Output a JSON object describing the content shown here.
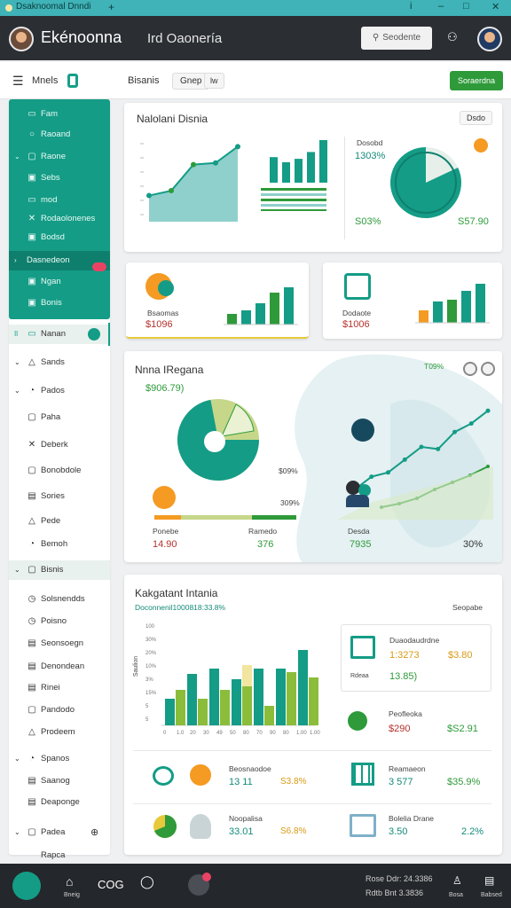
{
  "window": {
    "title": "Dsaknoomal Dnndi",
    "new_tab": "+",
    "info": "i",
    "minimize": "–",
    "maximize": "□",
    "close": "✕"
  },
  "header": {
    "brand": "Ekénoonna",
    "subtitle": "Ird Oaonería",
    "button": "Seodente",
    "icon": "people-icon"
  },
  "toolbar": {
    "menu_label": "Mnels",
    "title": "Bisanis",
    "chip1": "Gnep",
    "chip2": "lw",
    "action": "Soraerdna"
  },
  "sidebar": {
    "green_items": [
      {
        "label": "Fam",
        "icon": "card-icon"
      },
      {
        "label": "Raoand",
        "icon": "circle-icon"
      },
      {
        "label": "Raone",
        "icon": "doc-icon"
      },
      {
        "label": "Sebs",
        "icon": "box-icon"
      },
      {
        "label": "mod",
        "icon": "card-icon"
      },
      {
        "label": "Rodaolonenes",
        "icon": "tools-icon"
      },
      {
        "label": "Bodsd",
        "icon": "box-icon"
      },
      {
        "label": "Dasnedeon",
        "icon": ""
      },
      {
        "label": "Ngan",
        "icon": "box-icon"
      },
      {
        "label": "Bonis",
        "icon": "box-icon"
      }
    ],
    "selected_item": {
      "label": "Nanan",
      "prefix": "Il"
    },
    "items": [
      {
        "label": "Sands",
        "icon": "cloud-icon"
      },
      {
        "label": "Pados",
        "icon": "gear-icon"
      },
      {
        "label": "Paha",
        "icon": "doc-icon"
      },
      {
        "label": "Deberk",
        "icon": "tools-icon"
      },
      {
        "label": "Bonobdole",
        "icon": "doc-icon"
      },
      {
        "label": "Sories",
        "icon": "list-icon"
      },
      {
        "label": "Pede",
        "icon": "triangle-icon"
      },
      {
        "label": "Bemoh",
        "icon": "gear-icon"
      },
      {
        "label": "Bisnis",
        "icon": "doc-icon"
      },
      {
        "label": "Solsnendds",
        "icon": "clock-icon"
      },
      {
        "label": "Poisno",
        "icon": "clock-icon"
      },
      {
        "label": "Seonsoegn",
        "icon": "list-icon"
      },
      {
        "label": "Denondean",
        "icon": "list-icon"
      },
      {
        "label": "Rinei",
        "icon": "list-icon"
      },
      {
        "label": "Pandodo",
        "icon": "doc-icon"
      },
      {
        "label": "Prodeem",
        "icon": "triangle-icon"
      },
      {
        "label": "Spanos",
        "icon": "gear-icon"
      },
      {
        "label": "Saanog",
        "icon": "list-icon"
      },
      {
        "label": "Deaponge",
        "icon": "list-icon"
      },
      {
        "label": "Padea",
        "icon": "doc-icon"
      },
      {
        "label": "Rapca",
        "icon": ""
      }
    ]
  },
  "card1": {
    "title": "Nalolani Disnia",
    "button": "Dsdo",
    "line": {
      "values": [
        32,
        38,
        70,
        72,
        92
      ]
    },
    "bars": {
      "values": [
        30,
        24,
        28,
        36,
        50
      ]
    },
    "donut": {
      "legend": "Dosobd",
      "top_value": "1303%",
      "bottom_left": "S03%",
      "bottom_right": "S57.90",
      "fraction": 0.82
    }
  },
  "card2": {
    "label": "Bsaomas",
    "value": "$1096",
    "bars": [
      12,
      16,
      24,
      36,
      42
    ]
  },
  "card3": {
    "label": "Dodaote",
    "value": "$1006",
    "bars": [
      14,
      24,
      26,
      36,
      44
    ]
  },
  "card4": {
    "title": "Nnna IRegana",
    "subtitle": "$906.79)",
    "corner": "T09%",
    "pie_fraction": 0.72,
    "pct_label": "309%",
    "pct_label2": "$09%",
    "labels": [
      {
        "name": "Ponebe",
        "value": "14.90"
      },
      {
        "name": "Ramedo",
        "value": "376"
      },
      {
        "name": "Desda",
        "value": "7935"
      }
    ],
    "last": "30%",
    "trend": [
      20,
      32,
      36,
      48,
      60,
      58,
      74,
      82,
      94
    ],
    "trend2": [
      10,
      14,
      20,
      30,
      38,
      46,
      56
    ]
  },
  "card5": {
    "title": "Kakgatant Intania",
    "subtitle": "Doconnenil1000818:33.8%",
    "link": "Seopabe",
    "bars": {
      "teal": [
        30,
        58,
        64,
        52,
        64,
        64,
        85
      ],
      "green": [
        40,
        30,
        40,
        44,
        22,
        60,
        54
      ],
      "yellow": [
        0,
        0,
        0,
        68,
        0,
        0,
        0
      ]
    },
    "xticks": [
      "0",
      "1.0",
      "20",
      "30",
      "49",
      "50",
      "80",
      "70",
      "90",
      "80",
      "1.00",
      "1.00"
    ],
    "yticks": [
      "100",
      "30%",
      "20%",
      "10%",
      "3%",
      "15%",
      "5",
      "5"
    ],
    "ylabel": "Saulion",
    "panel": {
      "title": "Duaodaudrdne",
      "v1": "1:3273",
      "v2": "$3.80",
      "sub": "Rdeaa",
      "v3": "13.85)"
    },
    "row1": {
      "title": "Peofleoka",
      "v1": "$290",
      "v2": "$S2.91"
    },
    "row2": {
      "title": "Beosnaodoe",
      "v1": "13 11",
      "v2": "S3.8%"
    },
    "row3": {
      "title": "Reamaeon",
      "v1": "3 577",
      "v2": "$35.9%"
    },
    "row4": {
      "title": "Noopalisa",
      "v1": "33.01",
      "v2": "S6.8%"
    },
    "row5": {
      "title": "Bolelia Drane",
      "v1": "3.50",
      "v2": "2.2%"
    }
  },
  "bottombar": {
    "text": "COG",
    "status1": "Rose Ddr: 24.3386",
    "status2": "Rdtb Bnt 3.3836",
    "home_label": "Bneig",
    "user_label": "Bosa",
    "doc_label": "Babsed"
  },
  "colors": {
    "teal": "#149c86",
    "green": "#2e9a3a",
    "yellow": "#e8c93b",
    "red": "#e94364",
    "header": "#2b2e33"
  }
}
